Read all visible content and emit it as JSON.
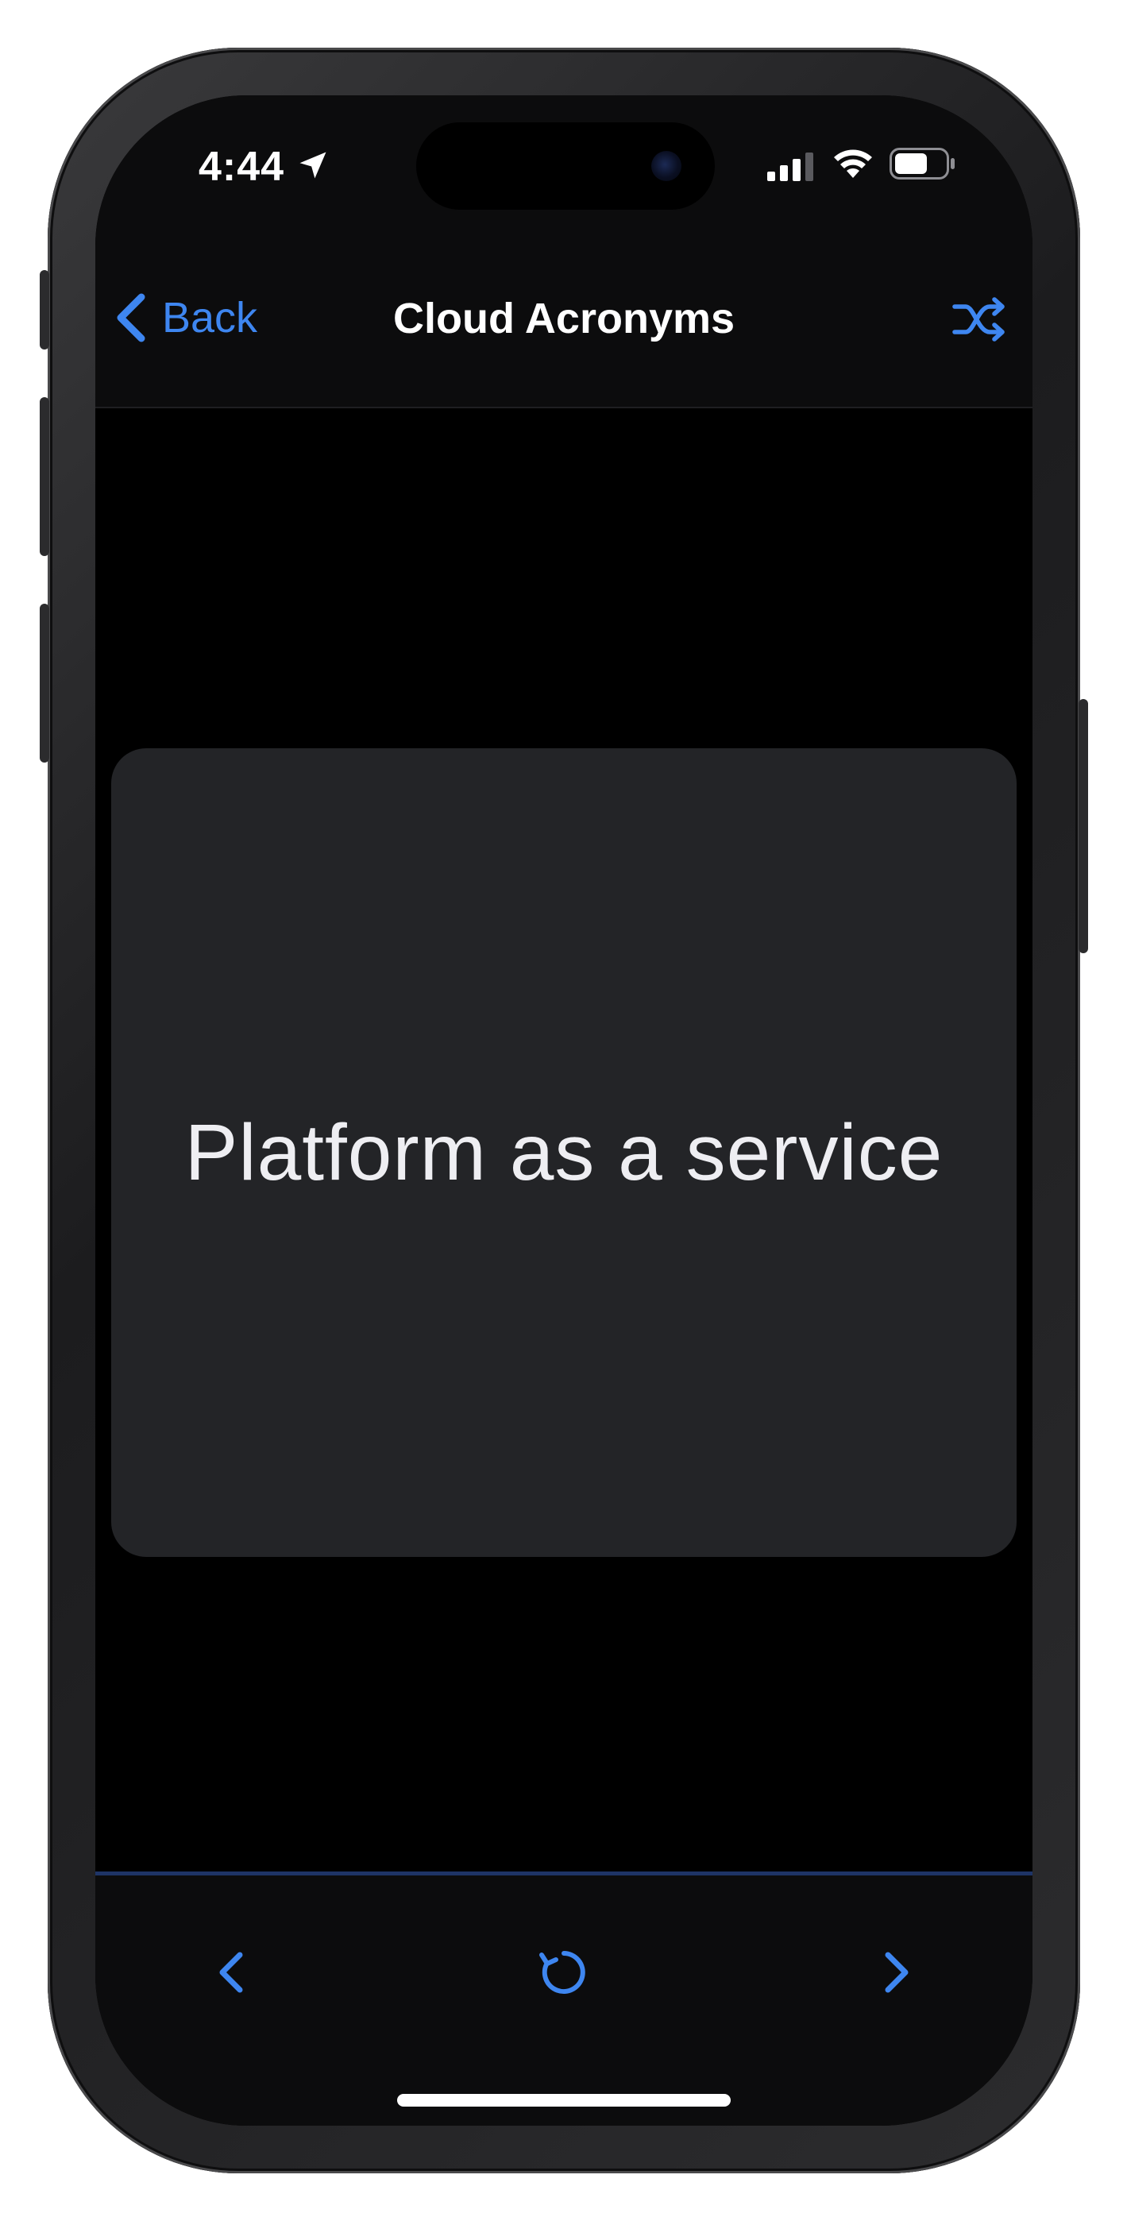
{
  "status_bar": {
    "time": "4:44",
    "icons": [
      "location-arrow-icon",
      "cellular-signal-icon",
      "wifi-icon",
      "battery-icon"
    ]
  },
  "nav_bar": {
    "back_label": "Back",
    "title": "Cloud Acronyms",
    "back_icon": "chevron-left-icon",
    "action_icon": "shuffle-icon"
  },
  "card": {
    "text": "Platform as a service"
  },
  "toolbar": {
    "items": [
      {
        "icon": "chevron-left-icon",
        "action": "previous"
      },
      {
        "icon": "flip-rotate-icon",
        "action": "flip"
      },
      {
        "icon": "chevron-right-icon",
        "action": "next"
      }
    ]
  },
  "colors": {
    "accent": "#3e86f0",
    "background": "#000000",
    "bar_background": "#0c0c0d",
    "card_background": "#232427",
    "card_text": "#eeeef2",
    "toolbar_divider": "#1e3466"
  }
}
